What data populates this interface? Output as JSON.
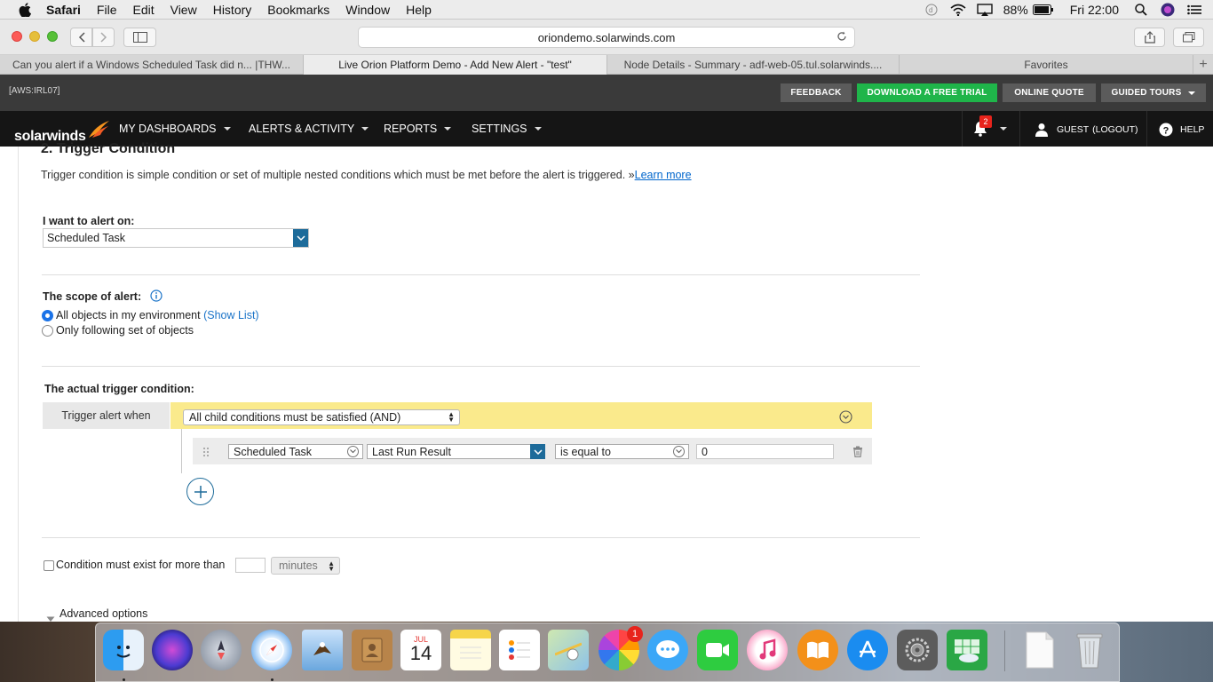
{
  "menubar": {
    "app": "Safari",
    "items": [
      "File",
      "Edit",
      "View",
      "History",
      "Bookmarks",
      "Window",
      "Help"
    ],
    "battery": "88%",
    "clock": "Fri 22:00"
  },
  "browser": {
    "url": "oriondemo.solarwinds.com",
    "tabs": [
      {
        "title": "Can you alert if a Windows Scheduled Task did n... |THW...",
        "active": false
      },
      {
        "title": "Live Orion Platform Demo - Add New Alert - \"test\"",
        "active": true
      },
      {
        "title": "Node Details - Summary - adf-web-05.tul.solarwinds....",
        "active": false
      },
      {
        "title": "Favorites",
        "active": false
      }
    ]
  },
  "header": {
    "env": "[AWS:IRL07]",
    "buttons": {
      "feedback": "FEEDBACK",
      "trial": "DOWNLOAD A FREE TRIAL",
      "quote": "ONLINE QUOTE",
      "tours": "GUIDED TOURS"
    }
  },
  "nav": {
    "logo": "solarwinds",
    "items": [
      "MY DASHBOARDS",
      "ALERTS & ACTIVITY",
      "REPORTS",
      "SETTINGS"
    ],
    "notifications": "2",
    "user": "GUEST",
    "logout": "(LOGOUT)",
    "help": "HELP"
  },
  "page": {
    "title": "2. Trigger Condition",
    "description": "Trigger condition is simple condition or set of multiple nested conditions which must be met before the alert is triggered. »",
    "learn_more": "Learn more",
    "alert_on_label": "I want to alert on:",
    "alert_on_value": "Scheduled Task",
    "scope_label": "The scope of alert:",
    "scope_options": [
      {
        "label": "All objects in my environment",
        "selected": true,
        "link": "(Show List)"
      },
      {
        "label": "Only following set of objects",
        "selected": false
      }
    ],
    "trigger_label": "The actual trigger condition:",
    "trigger_when": "Trigger alert when",
    "condition_mode": "All child conditions must be satisfied (AND)",
    "condition": {
      "object": "Scheduled Task",
      "field": "Last Run Result",
      "operator": "is equal to",
      "value": "0"
    },
    "exist_label": "Condition must exist for more than",
    "exist_value": "",
    "exist_unit": "minutes",
    "advanced": "Advanced options"
  },
  "dock": {
    "calendar_month": "JUL",
    "calendar_day": "14",
    "photos_badge": "1"
  },
  "colors": {
    "accent_blue": "#1d6b9a",
    "trial_green": "#1fb54a",
    "condition_yellow": "#faea8c",
    "navbar": "#151515"
  }
}
